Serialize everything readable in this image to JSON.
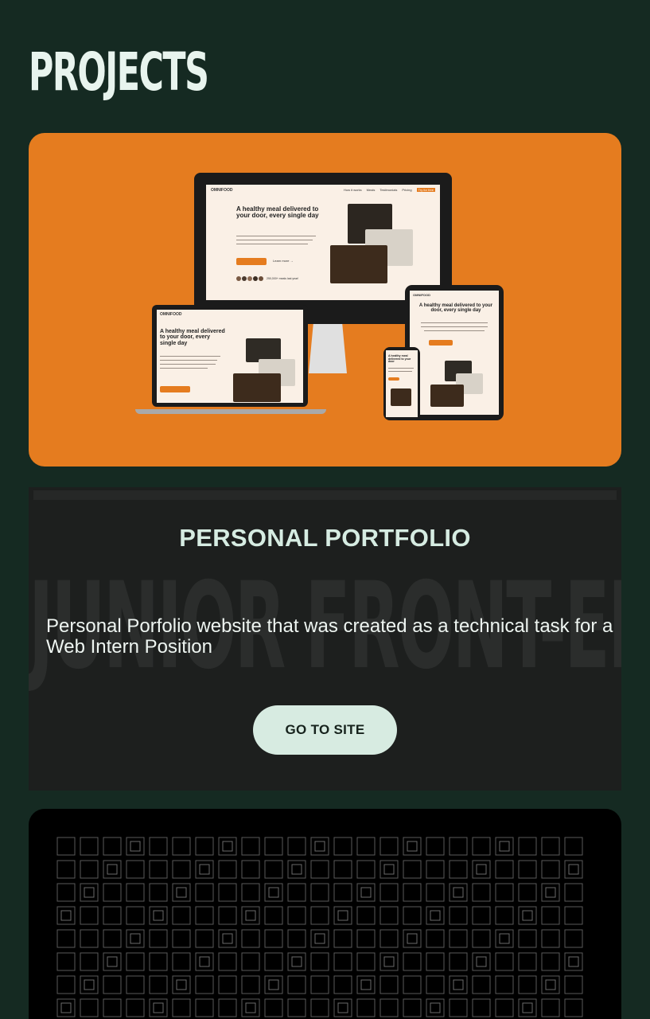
{
  "section": {
    "title": "PROJECTS"
  },
  "projects": [
    {
      "screen": {
        "logo": "OMNIFOOD",
        "nav": [
          "How it works",
          "Meals",
          "Testimonials",
          "Pricing",
          "Try for free"
        ],
        "hero_title": "A healthy meal delivered to your door, every single day",
        "cta_primary": "Start eating well",
        "cta_secondary": "Learn more →",
        "meals_count": "250,000+ meals last year!"
      }
    },
    {
      "title": "PERSONAL PORTFOLIO",
      "background_text": "JUNIOR FRONT-END DEVELOPER",
      "description": "Personal Porfolio website that was created as a technical task for a Web Intern Position",
      "button_label": "GO TO SITE"
    },
    {}
  ]
}
